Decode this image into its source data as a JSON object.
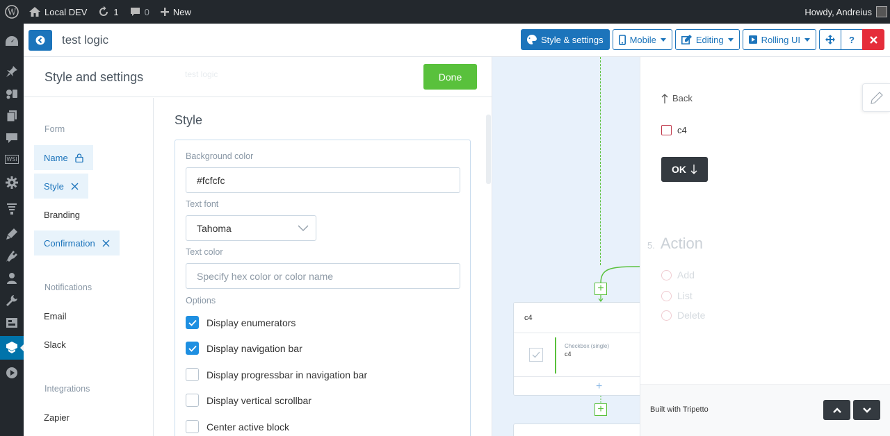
{
  "admin_bar": {
    "site_name": "Local DEV",
    "updates_count": "1",
    "comments_count": "0",
    "new_label": "New",
    "howdy": "Howdy, Andreius"
  },
  "wp_menu": {
    "wsi_label": "WSI"
  },
  "builder": {
    "form_title": "test logic",
    "style_settings_label": "Style & settings",
    "device_label": "Mobile",
    "mode_label": "Editing",
    "preview_style_label": "Rolling UI",
    "help_label": "?"
  },
  "panel": {
    "title": "Style and settings",
    "ghost_name": "test logic",
    "done_label": "Done",
    "nav": {
      "form_section": "Form",
      "name": "Name",
      "style": "Style",
      "branding": "Branding",
      "confirmation": "Confirmation",
      "notifications_section": "Notifications",
      "email": "Email",
      "slack": "Slack",
      "integrations_section": "Integrations",
      "zapier": "Zapier"
    },
    "style": {
      "heading": "Style",
      "bg_color_label": "Background color",
      "bg_color_value": "#fcfcfc",
      "text_font_label": "Text font",
      "text_font_value": "Tahoma",
      "text_color_label": "Text color",
      "text_color_placeholder": "Specify hex color or color name",
      "options_label": "Options",
      "options": [
        {
          "label": "Display enumerators",
          "checked": true
        },
        {
          "label": "Display navigation bar",
          "checked": true
        },
        {
          "label": "Display progressbar in navigation bar",
          "checked": false
        },
        {
          "label": "Display vertical scrollbar",
          "checked": false
        },
        {
          "label": "Center active block",
          "checked": false
        }
      ]
    }
  },
  "canvas": {
    "card_title": "c4",
    "block_type": "Checkbox (single)",
    "block_name": "c4"
  },
  "preview": {
    "back_label": "Back",
    "checkbox_label": "c4",
    "ok_label": "OK",
    "question_number": "5.",
    "question_title": "Action",
    "radio_options": [
      "Add",
      "List",
      "Delete"
    ],
    "built_with": "Built with Tripetto"
  },
  "colors": {
    "accent": "#1c74bb",
    "done_green": "#59c13c",
    "close_red": "#e52d3a",
    "admin_dark": "#23282d"
  }
}
